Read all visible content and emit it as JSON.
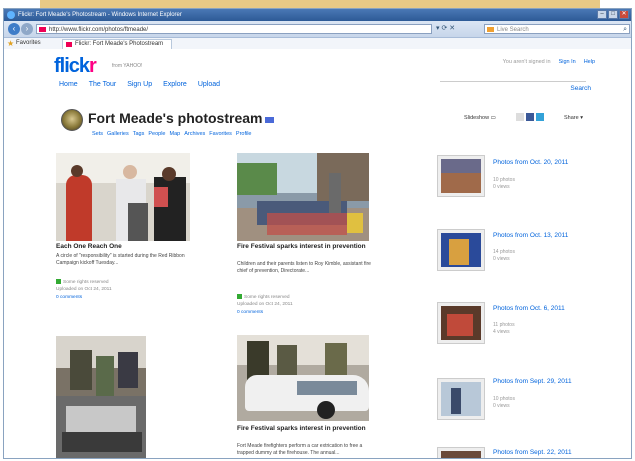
{
  "browser": {
    "window_title": "Flickr: Fort Meade's Photostream - Windows Internet Explorer",
    "url": "http://www.flickr.com/photos/ftmeade/",
    "search_placeholder": "Live Search",
    "favorites_label": "Favorites",
    "tab_label": "Flickr: Fort Meade's Photostream"
  },
  "flickr": {
    "logo_left": "flick",
    "logo_right": "r",
    "logo_tag": "from YAHOO!",
    "nav": [
      "Home",
      "The Tour",
      "Sign Up",
      "Explore",
      "Upload"
    ],
    "top_links": {
      "hint": "You aren't signed in",
      "sign_in": "Sign In",
      "help": "Help"
    },
    "search_label": "Search"
  },
  "photostream": {
    "title": "Fort Meade's photostream",
    "subnav": [
      "Sets",
      "Galleries",
      "Tags",
      "People",
      "Map",
      "Archives",
      "Favorites",
      "Profile"
    ],
    "slideshow_label": "Slideshow",
    "share_label": "Share"
  },
  "photos": [
    {
      "title": "Each One Reach One",
      "desc": "A circle of \"responsibility\" is started during the Red Ribbon Campaign kickoff Tuesday...",
      "rights": "Some rights reserved",
      "uploaded": "Uploaded on Oct 24, 2011",
      "comments": "0 comments"
    },
    {
      "title": "Fire Festival sparks interest in prevention",
      "desc": "Children and their parents listen to Roy Kimble, assistant fire chief of prevention, Directorate...",
      "rights": "Some rights reserved",
      "uploaded": "Uploaded on Oct 24, 2011",
      "comments": "0 comments"
    },
    {
      "title": "Fire Festival sparks interest in prevention",
      "desc": "Fort Meade firefighters perform a car extrication to free a trapped dummy at the firehouse. The annual..."
    }
  ],
  "sets": [
    {
      "title": "Photos from Oct. 20, 2011",
      "count": "10 photos",
      "views": "0 views"
    },
    {
      "title": "Photos from Oct. 13, 2011",
      "count": "14 photos",
      "views": "0 views"
    },
    {
      "title": "Photos from Oct. 6, 2011",
      "count": "11 photos",
      "views": "4 views"
    },
    {
      "title": "Photos from Sept. 29, 2011",
      "count": "10 photos",
      "views": "0 views"
    },
    {
      "title": "Photos from Sept. 22, 2011",
      "count": "",
      "views": ""
    }
  ]
}
